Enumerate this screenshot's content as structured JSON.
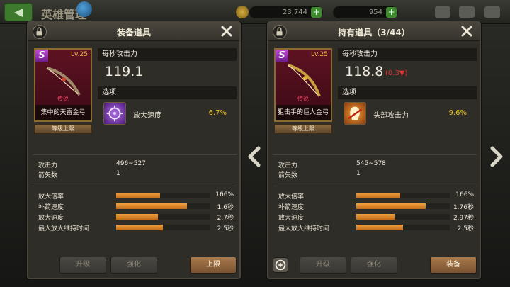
{
  "topbar": {
    "title": "英雄管理",
    "gold": "23,744",
    "gems": "954",
    "plus": "+"
  },
  "nav": {
    "left_arrow": "chevron-left-icon",
    "right_arrow": "chevron-right-icon"
  },
  "left_panel": {
    "title": "装备道具",
    "card": {
      "rarity": "S",
      "level": "Lv.25",
      "grade": "传说",
      "name": "集中的天雷金弓"
    },
    "level_limit_button": "等级上限",
    "dps_label": "每秒攻击力",
    "dps_value": "119.1",
    "option_label": "选项",
    "option": {
      "name": "放大速度",
      "value": "6.7%"
    },
    "stats": [
      {
        "label": "攻击力",
        "value": "496~527"
      },
      {
        "label": "箭矢数",
        "value": "1"
      }
    ],
    "bars": [
      {
        "label": "放大倍率",
        "value": "166%",
        "fill": 0.47
      },
      {
        "label": "补箭速度",
        "value": "1.6秒",
        "fill": 0.76
      },
      {
        "label": "放大速度",
        "value": "2.7秒",
        "fill": 0.45
      },
      {
        "label": "最大放大维持时间",
        "value": "2.5秒",
        "fill": 0.5
      }
    ],
    "buttons": {
      "upgrade": "升级",
      "enhance": "强化",
      "action": "上限"
    }
  },
  "right_panel": {
    "title": "持有道具（3/44）",
    "card": {
      "rarity": "S",
      "level": "Lv.25",
      "grade": "传说",
      "name": "狙击手的巨人金弓"
    },
    "level_limit_button": "等级上限",
    "dps_label": "每秒攻击力",
    "dps_value": "118.8",
    "dps_diff": "(0.3▼)",
    "option_label": "选项",
    "option": {
      "name": "头部攻击力",
      "value": "9.6%"
    },
    "stats": [
      {
        "label": "攻击力",
        "value": "545~578"
      },
      {
        "label": "箭矢数",
        "value": "1"
      }
    ],
    "bars": [
      {
        "label": "放大倍率",
        "value": "166%",
        "fill": 0.47
      },
      {
        "label": "补箭速度",
        "value": "1.76秒",
        "fill": 0.74
      },
      {
        "label": "放大速度",
        "value": "2.97秒",
        "fill": 0.41
      },
      {
        "label": "最大放大维持时间",
        "value": "2.5秒",
        "fill": 0.5
      }
    ],
    "buttons": {
      "upgrade": "升级",
      "enhance": "强化",
      "action": "装备"
    }
  },
  "colors": {
    "fill_orange": "#e8902c",
    "option_value": "#f0c020",
    "diff_red": "#e03030"
  }
}
